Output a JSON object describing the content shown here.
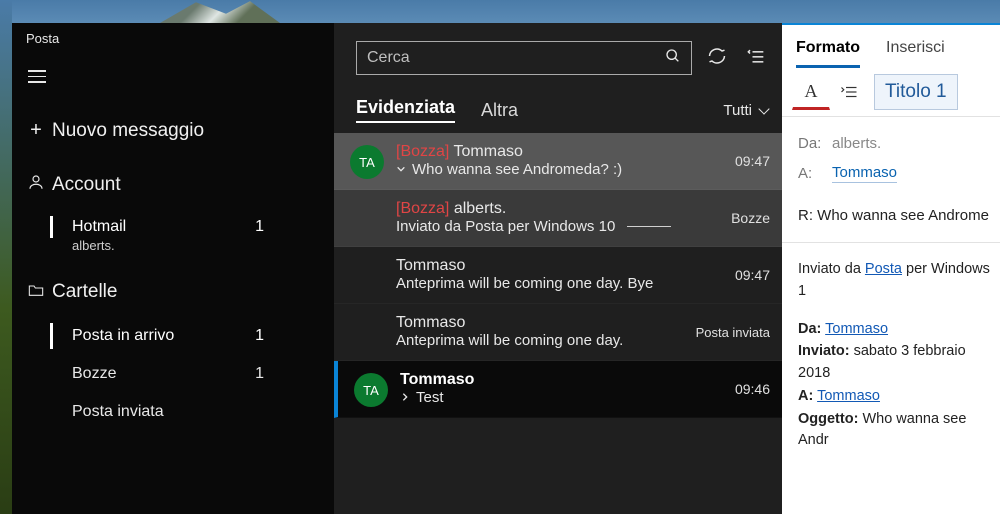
{
  "app": {
    "title": "Posta"
  },
  "sidebar": {
    "new_message": "Nuovo messaggio",
    "account_header": "Account",
    "accounts": [
      {
        "name": "Hotmail",
        "email": "alberts.",
        "count": "1"
      }
    ],
    "folders_header": "Cartelle",
    "folders": [
      {
        "name": "Posta in arrivo",
        "count": "1"
      },
      {
        "name": "Bozze",
        "count": "1"
      },
      {
        "name": "Posta inviata",
        "count": ""
      }
    ]
  },
  "search": {
    "placeholder": "Cerca"
  },
  "listTabs": {
    "focused": "Evidenziata",
    "other": "Altra",
    "filter": "Tutti"
  },
  "messages": [
    {
      "avatar": "TA",
      "draft_label": "[Bozza]",
      "from": "Tommaso",
      "expand": "down",
      "subject": "Who wanna see Andromeda? :)",
      "time": "09:47"
    },
    {
      "avatar": "",
      "draft_label": "[Bozza]",
      "from": "alberts.",
      "subject": "Inviato da Posta per Windows 10",
      "badge": "Bozze"
    },
    {
      "avatar": "",
      "from": "Tommaso",
      "subject": "Anteprima will be coming one day. Bye",
      "time": "09:47"
    },
    {
      "avatar": "",
      "from": "Tommaso",
      "subject": "Anteprima will be coming one day.",
      "badge": "Posta inviata"
    },
    {
      "avatar": "TA",
      "from": "Tommaso",
      "expand": "right",
      "subject": "Test",
      "time": "09:46"
    }
  ],
  "reading": {
    "tabs": {
      "format": "Formato",
      "insert": "Inserisci"
    },
    "style_name": "Titolo 1",
    "from_label": "Da:",
    "from_value": "alberts.",
    "to_label": "A:",
    "to_value": "Tommaso",
    "subject": "R: Who wanna see Androme",
    "body_sent_prefix": "Inviato da ",
    "body_sent_link": "Posta",
    "body_sent_suffix": " per Windows 1",
    "meta_from_label": "Da:",
    "meta_from_value": "Tommaso",
    "meta_sent_label": "Inviato:",
    "meta_sent_value": "sabato 3 febbraio 2018",
    "meta_to_label": "A:",
    "meta_to_value": "Tommaso",
    "meta_subj_label": "Oggetto:",
    "meta_subj_value": "Who wanna see Andr"
  }
}
